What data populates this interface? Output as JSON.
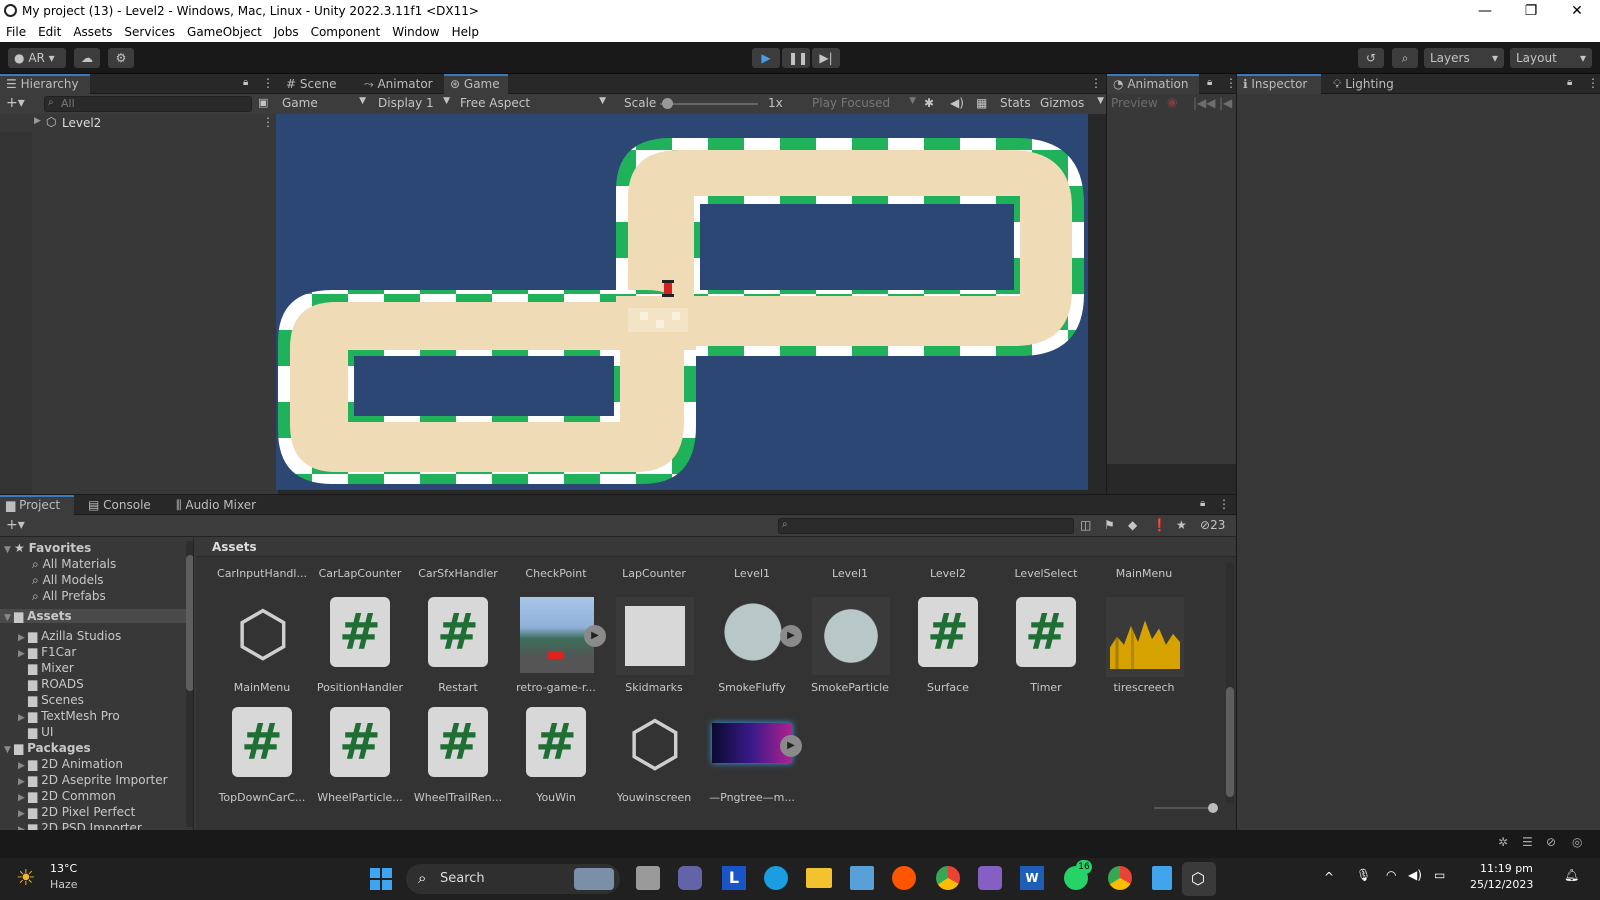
{
  "window": {
    "title": "My project (13) - Level2 - Windows, Mac, Linux - Unity 2022.3.11f1 <DX11>",
    "minimize": "—",
    "maximize": "❐",
    "close": "✕"
  },
  "menu": [
    "File",
    "Edit",
    "Assets",
    "Services",
    "GameObject",
    "Jobs",
    "Component",
    "Window",
    "Help"
  ],
  "toolbar": {
    "account": "AR",
    "layers": "Layers",
    "layout": "Layout"
  },
  "hierarchy": {
    "tab": "Hierarchy",
    "search_placeholder": "All",
    "root": "Level2"
  },
  "center_tabs": {
    "scene": "Scene",
    "animator": "Animator",
    "game": "Game"
  },
  "game_toolbar": {
    "mode": "Game",
    "display": "Display 1",
    "aspect": "Free Aspect",
    "scale_label": "Scale",
    "scale_value": "1x",
    "play_focused": "Play Focused",
    "stats": "Stats",
    "gizmos": "Gizmos"
  },
  "animation": {
    "tab": "Animation",
    "preview": "Preview"
  },
  "inspector": {
    "tab": "Inspector",
    "lighting": "Lighting"
  },
  "project": {
    "tabs": {
      "project": "Project",
      "console": "Console",
      "audio_mixer": "Audio Mixer"
    },
    "hidden_count": "23",
    "favorites_label": "Favorites",
    "favorites": [
      "All Materials",
      "All Models",
      "All Prefabs"
    ],
    "assets_label": "Assets",
    "assets_folders": [
      "Azilla Studios",
      "F1Car",
      "Mixer",
      "ROADS",
      "Scenes",
      "TextMesh Pro",
      "UI"
    ],
    "packages_label": "Packages",
    "packages": [
      "2D Animation",
      "2D Aseprite Importer",
      "2D Common",
      "2D Pixel Perfect",
      "2D PSD Importer"
    ],
    "breadcrumb": "Assets",
    "row0": [
      "CarInputHandl...",
      "CarLapCounter",
      "CarSfxHandler",
      "CheckPoint",
      "LapCounter",
      "Level1",
      "Level1",
      "Level2",
      "LevelSelect",
      "MainMenu"
    ],
    "row1": [
      {
        "name": "MainMenu",
        "kind": "unity"
      },
      {
        "name": "PositionHandler",
        "kind": "script"
      },
      {
        "name": "Restart",
        "kind": "script"
      },
      {
        "name": "retro-game-r...",
        "kind": "image"
      },
      {
        "name": "Skidmarks",
        "kind": "material"
      },
      {
        "name": "SmokeFluffy",
        "kind": "smoke"
      },
      {
        "name": "SmokeParticle",
        "kind": "smoke2"
      },
      {
        "name": "Surface",
        "kind": "script"
      },
      {
        "name": "Timer",
        "kind": "script"
      },
      {
        "name": "tirescreech",
        "kind": "audio"
      }
    ],
    "row2": [
      {
        "name": "TopDownCarC...",
        "kind": "script"
      },
      {
        "name": "WheelParticle...",
        "kind": "script"
      },
      {
        "name": "WheelTrailRen...",
        "kind": "script"
      },
      {
        "name": "YouWin",
        "kind": "script"
      },
      {
        "name": "Youwinscreen",
        "kind": "unity"
      },
      {
        "name": "—Pngtree—m...",
        "kind": "neon"
      }
    ]
  },
  "taskbar": {
    "weather_temp": "13°C",
    "weather_desc": "Haze",
    "search": "Search",
    "time": "11:19 pm",
    "date": "25/12/2023",
    "whatsapp_badge": "16"
  },
  "colors": {
    "accent": "#3a79bb",
    "game_bg": "#2d4775",
    "track": "#efdcb6",
    "curb_green": "#1fb25a"
  }
}
